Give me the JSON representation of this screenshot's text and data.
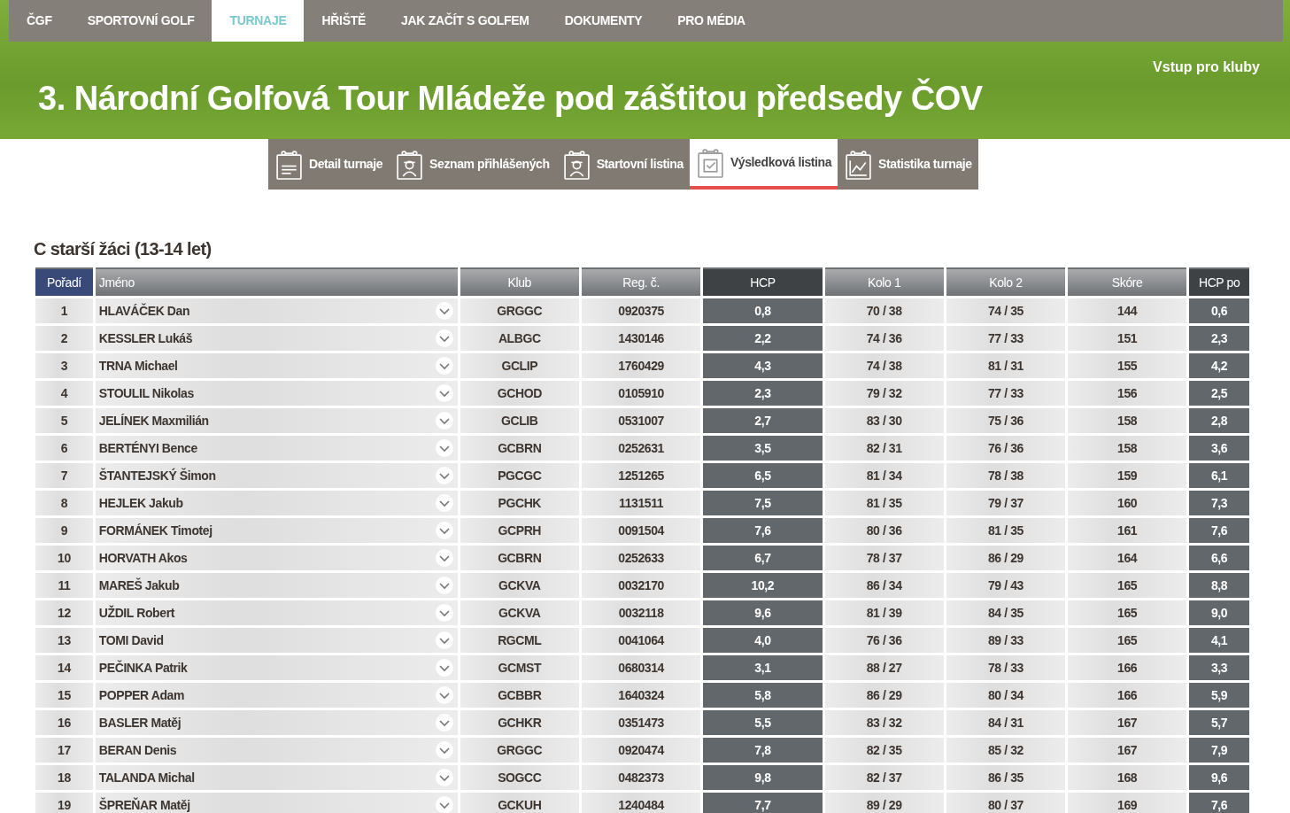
{
  "nav": [
    {
      "label": "ČGF",
      "selected": false
    },
    {
      "label": "SPORTOVNÍ GOLF",
      "selected": false
    },
    {
      "label": "TURNAJE",
      "selected": true
    },
    {
      "label": "HŘIŠTĚ",
      "selected": false
    },
    {
      "label": "JAK ZAČÍT S GOLFEM",
      "selected": false
    },
    {
      "label": "DOKUMENTY",
      "selected": false
    },
    {
      "label": "PRO MÉDIA",
      "selected": false
    }
  ],
  "club_login": "Vstup pro kluby",
  "title": "3. Národní Golfová Tour Mládeže pod záštitou předsedy ČOV",
  "tabs": [
    {
      "label": "Detail turnaje",
      "kind": "list",
      "selected": false
    },
    {
      "label": "Seznam přihlášených",
      "kind": "person",
      "selected": false
    },
    {
      "label": "Startovní listina",
      "kind": "person",
      "selected": false
    },
    {
      "label": "Výsledková listina",
      "kind": "check",
      "selected": true
    },
    {
      "label": "Statistika turnaje",
      "kind": "chart",
      "selected": false
    }
  ],
  "section_title": "C starší žáci (13-14 let)",
  "table": {
    "columns": [
      "Pořadí",
      "Jméno",
      "Klub",
      "Reg. č.",
      "HCP",
      "Kolo 1",
      "Kolo 2",
      "Skóre",
      "HCP po"
    ],
    "rows": [
      [
        "1",
        "HLAVÁČEK Dan",
        "GRGGC",
        "0920375",
        "0,8",
        "70 / 38",
        "74 / 35",
        "144",
        "0,6"
      ],
      [
        "2",
        "KESSLER Lukáš",
        "ALBGC",
        "1430146",
        "2,2",
        "74 / 36",
        "77 / 33",
        "151",
        "2,3"
      ],
      [
        "3",
        "TRNA Michael",
        "GCLIP",
        "1760429",
        "4,3",
        "74 / 38",
        "81 / 31",
        "155",
        "4,2"
      ],
      [
        "4",
        "STOULIL Nikolas",
        "GCHOD",
        "0105910",
        "2,3",
        "79 / 32",
        "77 / 33",
        "156",
        "2,5"
      ],
      [
        "5",
        "JELÍNEK Maxmilián",
        "GCLIB",
        "0531007",
        "2,7",
        "83 / 30",
        "75 / 36",
        "158",
        "2,8"
      ],
      [
        "6",
        "BERTÉNYI Bence",
        "GCBRN",
        "0252631",
        "3,5",
        "82 / 31",
        "76 / 36",
        "158",
        "3,6"
      ],
      [
        "7",
        "ŠTANTEJSKÝ Šimon",
        "PGCGC",
        "1251265",
        "6,5",
        "81 / 34",
        "78 / 38",
        "159",
        "6,1"
      ],
      [
        "8",
        "HEJLEK Jakub",
        "PGCHK",
        "1131511",
        "7,5",
        "81 / 35",
        "79 / 37",
        "160",
        "7,3"
      ],
      [
        "9",
        "FORMÁNEK Timotej",
        "GCPRH",
        "0091504",
        "7,6",
        "80 / 36",
        "81 / 35",
        "161",
        "7,6"
      ],
      [
        "10",
        "HORVATH Akos",
        "GCBRN",
        "0252633",
        "6,7",
        "78 / 37",
        "86 / 29",
        "164",
        "6,6"
      ],
      [
        "11",
        "MAREŠ Jakub",
        "GCKVA",
        "0032170",
        "10,2",
        "86 / 34",
        "79 / 43",
        "165",
        "8,8"
      ],
      [
        "12",
        "UŽDIL Robert",
        "GCKVA",
        "0032118",
        "9,6",
        "81 / 39",
        "84 / 35",
        "165",
        "9,0"
      ],
      [
        "13",
        "TOMI David",
        "RGCML",
        "0041064",
        "4,0",
        "76 / 36",
        "89 / 33",
        "165",
        "4,1"
      ],
      [
        "14",
        "PEČINKA Patrik",
        "GCMST",
        "0680314",
        "3,1",
        "88 / 27",
        "78 / 33",
        "166",
        "3,3"
      ],
      [
        "15",
        "POPPER Adam",
        "GCBBR",
        "1640324",
        "5,8",
        "86 / 29",
        "80 / 34",
        "166",
        "5,9"
      ],
      [
        "16",
        "BASLER Matěj",
        "GCHKR",
        "0351473",
        "5,5",
        "83 / 32",
        "84 / 31",
        "167",
        "5,7"
      ],
      [
        "17",
        "BERAN Denis",
        "GRGGC",
        "0920474",
        "7,8",
        "82 / 35",
        "85 / 32",
        "167",
        "7,9"
      ],
      [
        "18",
        "TALANDA Michal",
        "SOGCC",
        "0482373",
        "9,8",
        "82 / 37",
        "86 / 35",
        "168",
        "9,6"
      ],
      [
        "19",
        "ŠPREŇAR Matěj",
        "GCKUH",
        "1240484",
        "7,7",
        "89 / 29",
        "80 / 37",
        "169",
        "7,6"
      ]
    ]
  }
}
